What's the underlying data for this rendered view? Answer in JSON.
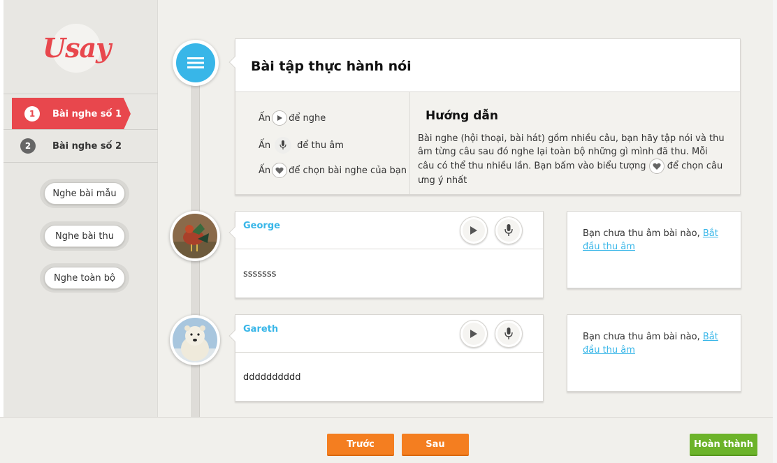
{
  "brand": {
    "logo": "Usay",
    "accent": "#e8474d",
    "blue": "#38b6e8"
  },
  "sidebar": {
    "lessons": [
      {
        "num": "1",
        "label": "Bài nghe số 1",
        "active": true
      },
      {
        "num": "2",
        "label": "Bài nghe số 2",
        "active": false
      }
    ],
    "buttons": [
      "Nghe bài mẫu",
      "Nghe bài thu",
      "Nghe toàn bộ"
    ]
  },
  "header": {
    "title": "Bài tập thực hành nói",
    "hints": [
      {
        "prefix": "Ấn",
        "icon": "play-icon",
        "text": "để nghe"
      },
      {
        "prefix": "Ấn",
        "icon": "microphone-icon",
        "text": "để thu âm"
      },
      {
        "prefix": "Ấn",
        "icon": "heart-icon",
        "text": "để chọn bài nghe của bạn"
      }
    ],
    "guide_title": "Hướng dẫn",
    "guide_body_1": "Bài nghe (hội thoại, bài hát) gồm nhiều câu, bạn hãy tập nói và thu âm từng câu sau đó nghe lại toàn bộ những gì mình đã thu. Mỗi câu có thể thu nhiều lần. Bạn bấm vào biểu tượng",
    "guide_body_2": "để chọn câu ưng ý nhất"
  },
  "sentences": [
    {
      "speaker": "George",
      "text": "sssssss",
      "status": "Bạn chưa thu âm bài nào,",
      "link": "Bắt đầu thu âm"
    },
    {
      "speaker": "Gareth",
      "text": "dddddddddd",
      "status": "Bạn chưa thu âm bài nào,",
      "link": "Bắt đầu thu âm"
    }
  ],
  "footer": {
    "prev": "Trước",
    "next": "Sau",
    "finish": "Hoàn thành"
  }
}
